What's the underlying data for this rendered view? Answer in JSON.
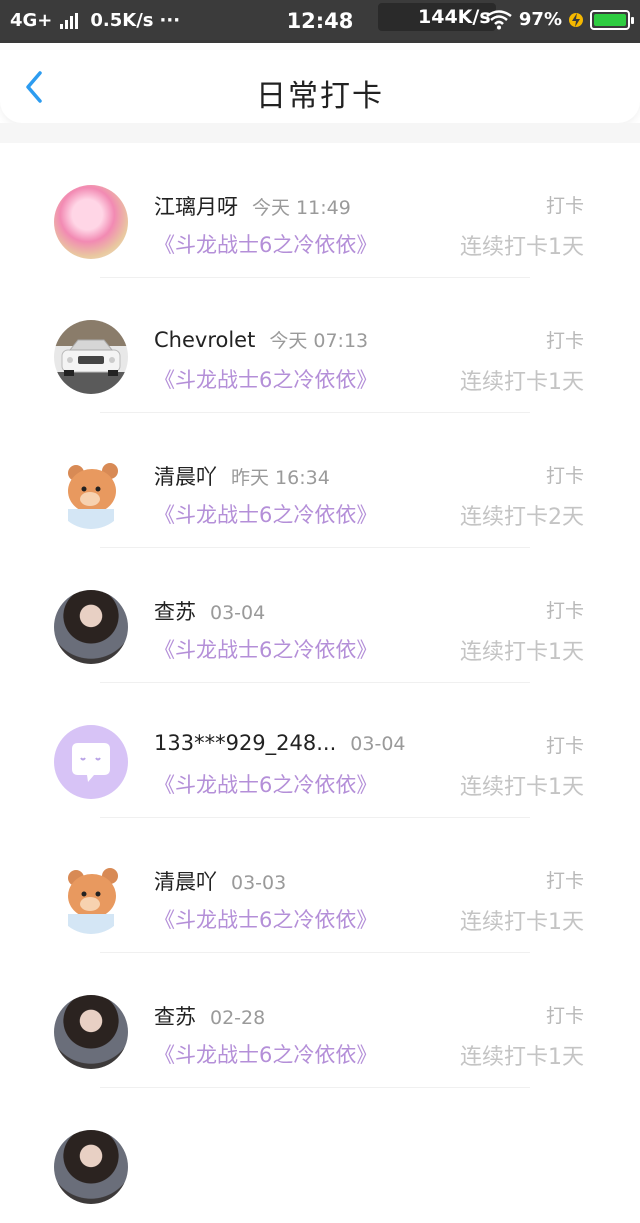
{
  "status_bar": {
    "network": "4G+",
    "speed_left": "0.5K/s",
    "more": "···",
    "time": "12:48",
    "speed_right": "144K/s",
    "battery": "97%"
  },
  "header": {
    "title": "日常打卡",
    "back_icon": "chevron-left-icon"
  },
  "colors": {
    "accent": "#2d9cf0",
    "book_title": "#b48fd8",
    "muted": "#bdbdbd",
    "status_bar": "#3b3b3b"
  },
  "items": [
    {
      "name": "江璃月呀",
      "time": "今天 11:49",
      "book": "《斗龙战士6之冷依依》",
      "checkin": "打卡",
      "streak": "连续打卡1天"
    },
    {
      "name": "Chevrolet",
      "time": "今天 07:13",
      "book": "《斗龙战士6之冷依依》",
      "checkin": "打卡",
      "streak": "连续打卡1天"
    },
    {
      "name": "清晨吖",
      "time": "昨天 16:34",
      "book": "《斗龙战士6之冷依依》",
      "checkin": "打卡",
      "streak": "连续打卡2天"
    },
    {
      "name": "查苏",
      "time": "03-04",
      "book": "《斗龙战士6之冷依依》",
      "checkin": "打卡",
      "streak": "连续打卡1天"
    },
    {
      "name": "133***929_248...",
      "time": "03-04",
      "book": "《斗龙战士6之冷依依》",
      "checkin": "打卡",
      "streak": "连续打卡1天"
    },
    {
      "name": "清晨吖",
      "time": "03-03",
      "book": "《斗龙战士6之冷依依》",
      "checkin": "打卡",
      "streak": "连续打卡1天"
    },
    {
      "name": "查苏",
      "time": "02-28",
      "book": "《斗龙战士6之冷依依》",
      "checkin": "打卡",
      "streak": "连续打卡1天"
    }
  ]
}
